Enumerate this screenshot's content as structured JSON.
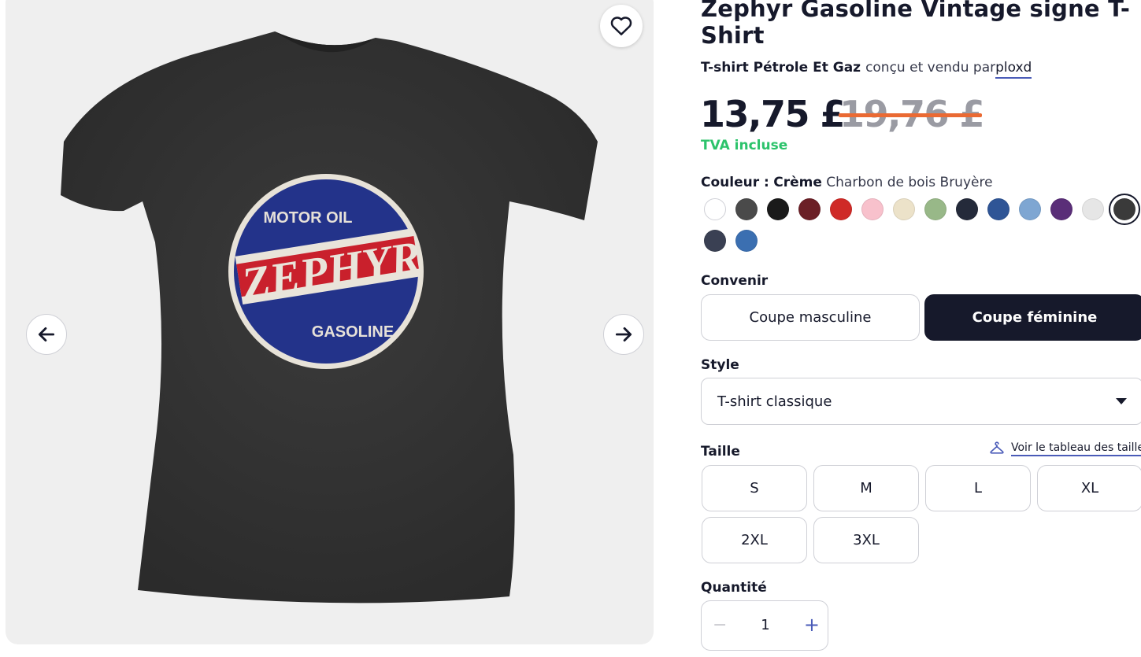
{
  "product": {
    "title": "Zephyr Gasoline Vintage signe T-Shirt",
    "category": "T-shirt Pétrole Et Gaz",
    "by_text": "conçu et vendu par",
    "artist": "ploxd",
    "price": "13,75 £",
    "old_price": "19,76 £",
    "vat": "TVA incluse"
  },
  "gallery": {
    "logo_top": "MOTOR OIL",
    "logo_brand": "ZEPHYR",
    "logo_bottom": "GASOLINE",
    "icons": {
      "favorite": "heart-icon",
      "prev": "arrow-left-icon",
      "next": "arrow-right-icon"
    }
  },
  "color": {
    "label": "Couleur :",
    "selected": "Crème",
    "others": "Charbon de bois Bruyère",
    "swatches": [
      {
        "name": "white",
        "hex": "#ffffff"
      },
      {
        "name": "charcoal",
        "hex": "#4a4a4a"
      },
      {
        "name": "black",
        "hex": "#1a1a1a"
      },
      {
        "name": "maroon",
        "hex": "#6b1f26"
      },
      {
        "name": "red",
        "hex": "#cf2a27"
      },
      {
        "name": "pink",
        "hex": "#f8c1cc"
      },
      {
        "name": "cream",
        "hex": "#ece2c9"
      },
      {
        "name": "sage",
        "hex": "#98b888"
      },
      {
        "name": "navy",
        "hex": "#242a3a"
      },
      {
        "name": "royal",
        "hex": "#2f5596"
      },
      {
        "name": "light-blue",
        "hex": "#7ea6d2"
      },
      {
        "name": "purple",
        "hex": "#5a2e78"
      },
      {
        "name": "heather-white",
        "hex": "#e6e6e6"
      },
      {
        "name": "charcoal-heather",
        "hex": "#3a3a3a",
        "selected": true
      },
      {
        "name": "dark-slate",
        "hex": "#3a4053"
      },
      {
        "name": "blue-heather",
        "hex": "#3b6fb1"
      }
    ]
  },
  "fit": {
    "label": "Convenir",
    "options": [
      "Coupe masculine",
      "Coupe féminine"
    ],
    "selected": "Coupe féminine"
  },
  "style": {
    "label": "Style",
    "selected": "T-shirt classique"
  },
  "size": {
    "label": "Taille",
    "chart_link": "Voir le tableau des tailles",
    "options": [
      "S",
      "M",
      "L",
      "XL",
      "2XL",
      "3XL"
    ]
  },
  "quantity": {
    "label": "Quantité",
    "value": "1",
    "minus": "−",
    "plus": "+"
  }
}
